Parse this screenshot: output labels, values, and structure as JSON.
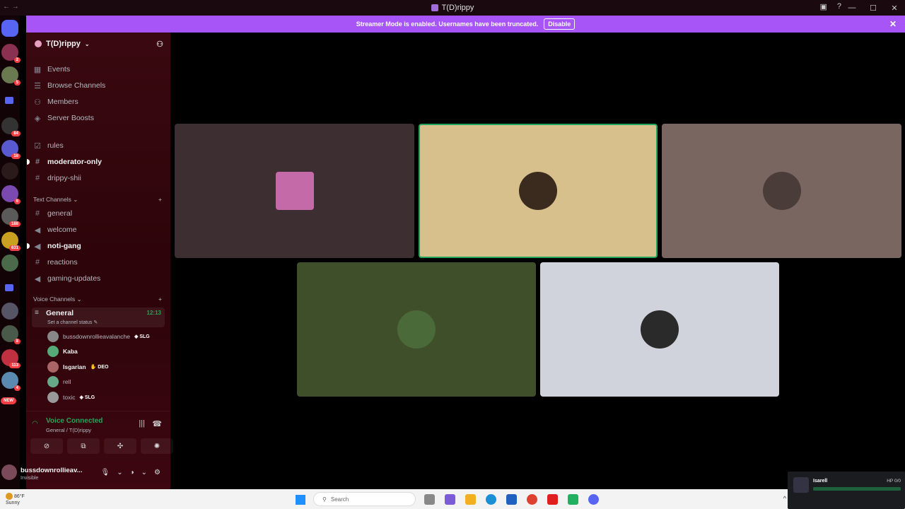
{
  "window": {
    "title": "T(D)rippy",
    "nav_arrows": "← →"
  },
  "banner": {
    "message": "Streamer Mode is enabled. Usernames have been truncated.",
    "disable_label": "Disable",
    "close_glyph": "✕"
  },
  "guild_badges": [
    "2",
    "5",
    "84",
    "16",
    "6",
    "188",
    "631",
    "8",
    "113",
    "4",
    "NEW"
  ],
  "server": {
    "name": "T(D)rippy",
    "menu_items": [
      {
        "label": "Events",
        "icon": "calendar-icon"
      },
      {
        "label": "Browse Channels",
        "icon": "browse-icon"
      },
      {
        "label": "Members",
        "icon": "members-icon"
      },
      {
        "label": "Server Boosts",
        "icon": "boost-icon"
      }
    ],
    "top_channels": [
      {
        "label": "rules",
        "icon": "rules-icon"
      },
      {
        "label": "moderator-only",
        "icon": "hash-icon"
      },
      {
        "label": "drippy-shii",
        "icon": "hash-icon"
      }
    ],
    "text_category": "Text Channels",
    "text_channels": [
      {
        "label": "general"
      },
      {
        "label": "welcome"
      },
      {
        "label": "noti-gang"
      },
      {
        "label": "reactions"
      },
      {
        "label": "gaming-updates"
      }
    ],
    "voice_category": "Voice Channels",
    "voice_channel": {
      "name": "General",
      "time": "12:13",
      "status": "Set a channel status"
    },
    "voice_users": [
      {
        "name": "bussdownrollieavalanche",
        "tag": "SLG",
        "color": "#888"
      },
      {
        "name": "Kaba",
        "tag": "",
        "color": "#5a7"
      },
      {
        "name": "Isgarian",
        "tag": "DEO",
        "color": "#a66"
      },
      {
        "name": "rell",
        "tag": "",
        "color": "#6a8"
      },
      {
        "name": "toxic",
        "tag": "SLG",
        "color": "#999"
      }
    ]
  },
  "voice_connection": {
    "title": "Voice Connected",
    "subtitle": "General / T(D)rippy"
  },
  "user": {
    "name": "bussdownrollieav...",
    "status": "Invisible"
  },
  "video_tiles": [
    {
      "bg": "#3d2e31",
      "avatar": "#c46aa8"
    },
    {
      "bg": "#d7c08b",
      "avatar": "#3b2a1e"
    },
    {
      "bg": "#7a6660",
      "avatar": "#4a3c38"
    },
    {
      "bg": "#3f4f2a",
      "avatar": "#4a6a3a"
    },
    {
      "bg": "#d0d2dc",
      "avatar": "#2a2a2a"
    }
  ],
  "taskbar": {
    "temp": "86°F",
    "weather": "Sunny",
    "search_placeholder": "Search"
  },
  "overlay": {
    "name": "Isarell",
    "hp": "HP 0/0"
  }
}
